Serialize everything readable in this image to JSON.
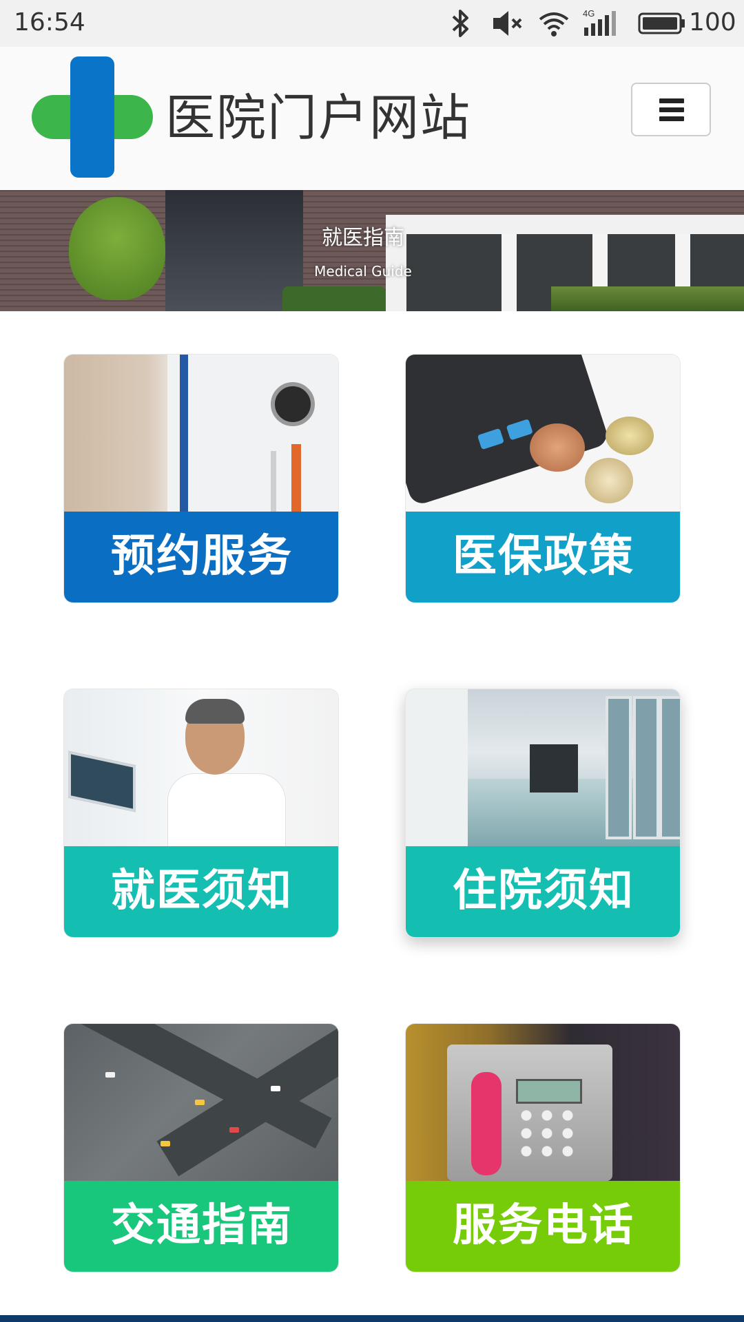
{
  "status_bar": {
    "time": "16:54",
    "icons": [
      "bluetooth-icon",
      "mute-icon",
      "wifi-icon",
      "signal-4g-icon",
      "battery-icon"
    ],
    "network_label": "4G",
    "battery": "100"
  },
  "header": {
    "site_title": "医院门户网站",
    "logo_colors": {
      "horizontal": "#3cb54a",
      "vertical": "#0a74c8"
    },
    "menu_icon": "hamburger-icon"
  },
  "banner": {
    "title": "就医指南",
    "subtitle": "Medical Guide"
  },
  "cards": [
    {
      "label": "预约服务",
      "color": "#0a6fc2",
      "image": "doctor-coat-stethoscope"
    },
    {
      "label": "医保政策",
      "color": "#10a0c8",
      "image": "calculator-coins"
    },
    {
      "label": "就医须知",
      "color": "#14bfb2",
      "image": "doctor-clinic-portrait"
    },
    {
      "label": "住院须知",
      "color": "#14bfb2",
      "image": "hospital-corridor"
    },
    {
      "label": "交通指南",
      "color": "#18c77b",
      "image": "city-traffic-aerial"
    },
    {
      "label": "服务电话",
      "color": "#77cc0a",
      "image": "payphone"
    }
  ],
  "footer": {
    "color": "#0d3a69"
  }
}
